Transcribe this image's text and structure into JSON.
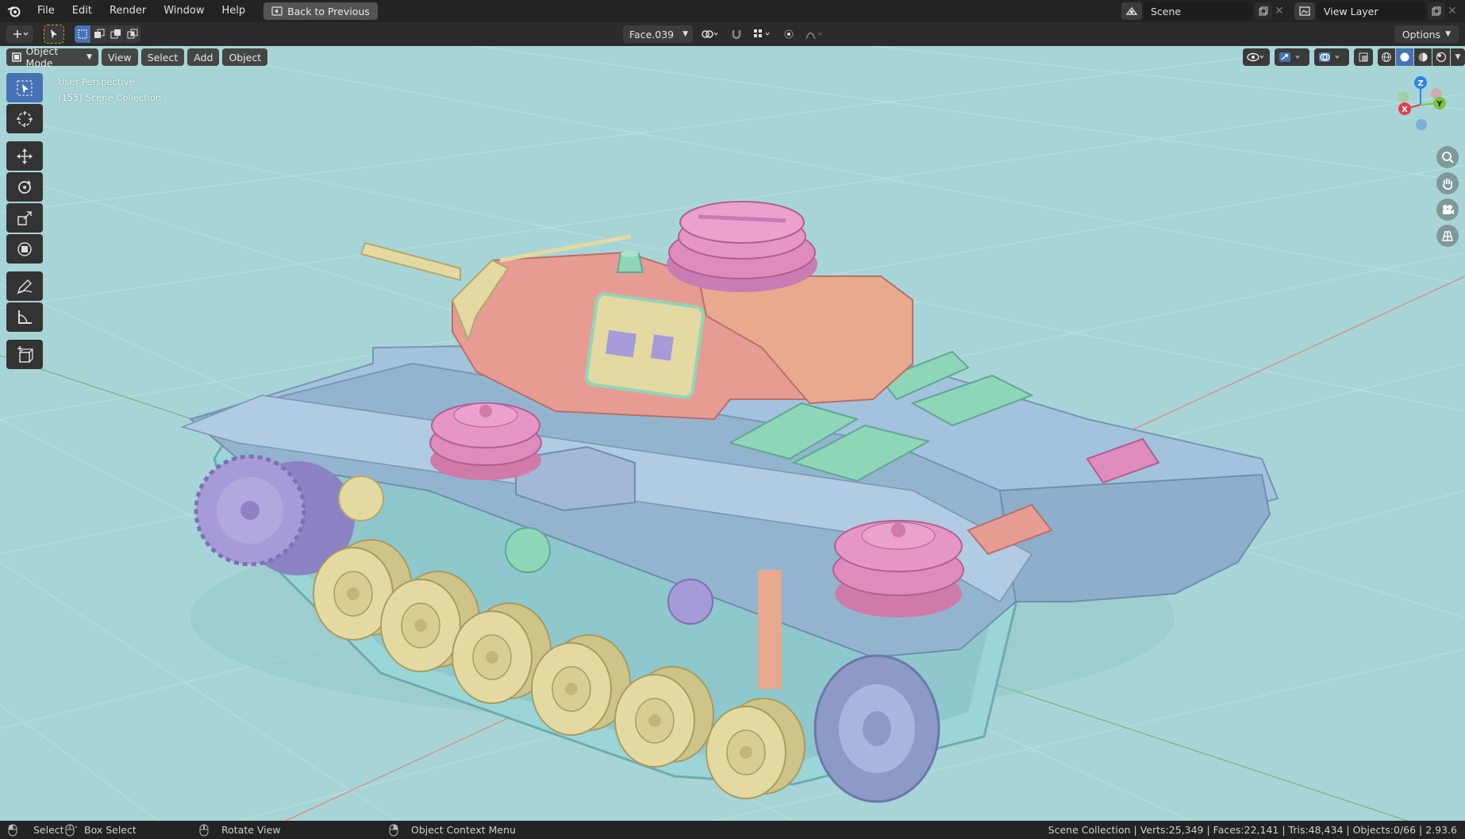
{
  "menu": {
    "items": [
      "File",
      "Edit",
      "Render",
      "Window",
      "Help"
    ],
    "back_button": "Back to Previous"
  },
  "scene": {
    "label": "Scene"
  },
  "view_layer": {
    "label": "View Layer"
  },
  "tool_header": {
    "face_field": "Face.039",
    "options_label": "Options"
  },
  "viewport": {
    "mode": "Object Mode",
    "menus": [
      "View",
      "Select",
      "Add",
      "Object"
    ],
    "perspective_label": "User Perspective",
    "collection_label": "(155) Scene Collection",
    "gizmo_axes": {
      "z": "Z",
      "y": "Y",
      "x": "X"
    }
  },
  "tools": [
    {
      "name": "select-box",
      "icon": "cursor-arrow-icon"
    },
    {
      "name": "cursor",
      "icon": "crosshair-icon"
    },
    {
      "name": "move",
      "icon": "move-arrows-icon"
    },
    {
      "name": "rotate",
      "icon": "rotate-icon"
    },
    {
      "name": "scale",
      "icon": "scale-icon"
    },
    {
      "name": "transform",
      "icon": "transform-icon"
    },
    {
      "name": "annotate",
      "icon": "pencil-icon"
    },
    {
      "name": "measure",
      "icon": "ruler-icon"
    },
    {
      "name": "add-cube",
      "icon": "add-cube-icon"
    }
  ],
  "status": {
    "select": "Select",
    "box_select": "Box Select",
    "rotate_view": "Rotate View",
    "context_menu": "Object Context Menu",
    "stats": "Scene Collection | Verts:25,349 | Faces:22,141 | Tris:48,434 | Objects:0/66 | 2.93.6"
  },
  "colors": {
    "accent": "#4772b3",
    "viewport_bg": "#a7d5d7",
    "tank_hull": "#93b4cf",
    "tank_turret": "#e79c93",
    "wheels": "#e3d9a1",
    "pink_parts": "#e08bbd",
    "green_parts": "#8fd6b8",
    "purple_parts": "#a79ad8"
  }
}
